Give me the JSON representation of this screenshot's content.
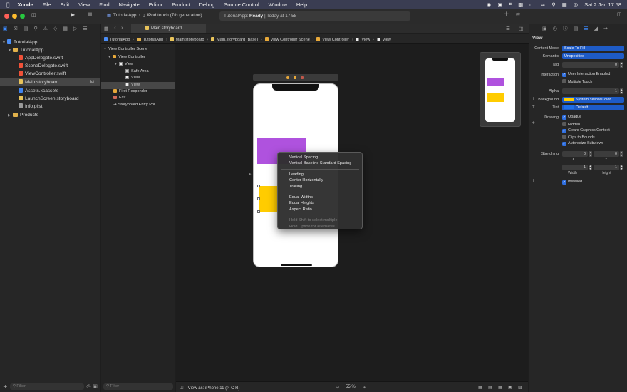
{
  "menubar": {
    "items": [
      "Xcode",
      "File",
      "Edit",
      "View",
      "Find",
      "Navigate",
      "Editor",
      "Product",
      "Debug",
      "Source Control",
      "Window",
      "Help"
    ],
    "clock": "Sat 2 Jan  17:58"
  },
  "toolbar": {
    "scheme": "TutorialApp",
    "destination": "iPod touch (7th generation)",
    "activity_app": "TutorialApp:",
    "activity_status": "Ready",
    "activity_time": "| Today at 17:58"
  },
  "editor_tab": {
    "label": "Main.storyboard"
  },
  "breadcrumbs": [
    "TutorialApp",
    "TutorialApp",
    "Main.storyboard",
    "Main.storyboard (Base)",
    "View Controller Scene",
    "View Controller",
    "View",
    "View"
  ],
  "navigator": {
    "items": [
      {
        "label": "TutorialApp",
        "kind": "project",
        "depth": 0
      },
      {
        "label": "TutorialApp",
        "kind": "folder",
        "depth": 1
      },
      {
        "label": "AppDelegate.swift",
        "kind": "swift",
        "depth": 2
      },
      {
        "label": "SceneDelegate.swift",
        "kind": "swift",
        "depth": 2
      },
      {
        "label": "ViewController.swift",
        "kind": "swift",
        "depth": 2
      },
      {
        "label": "Main.storyboard",
        "kind": "storyboard",
        "depth": 2,
        "badge": "M"
      },
      {
        "label": "Assets.xcassets",
        "kind": "assets",
        "depth": 2
      },
      {
        "label": "LaunchScreen.storyboard",
        "kind": "storyboard",
        "depth": 2
      },
      {
        "label": "Info.plist",
        "kind": "plist",
        "depth": 2
      },
      {
        "label": "Products",
        "kind": "folder",
        "depth": 1
      }
    ],
    "filter_placeholder": "Filter"
  },
  "outline": {
    "items": [
      {
        "label": "View Controller Scene",
        "depth": 0
      },
      {
        "label": "View Controller",
        "depth": 1
      },
      {
        "label": "View",
        "depth": 2
      },
      {
        "label": "Safe Area",
        "depth": 3
      },
      {
        "label": "View",
        "depth": 3
      },
      {
        "label": "View",
        "depth": 3
      },
      {
        "label": "First Responder",
        "depth": 1
      },
      {
        "label": "Exit",
        "depth": 1
      },
      {
        "label": "Storyboard Entry Poi...",
        "depth": 1
      }
    ],
    "filter_placeholder": "Filter"
  },
  "context_menu": {
    "group1": [
      "Vertical Spacing",
      "Vertical Baseline Standard Spacing"
    ],
    "group2": [
      "Leading",
      "Center Horizontally",
      "Trailing"
    ],
    "group3": [
      "Equal Widths",
      "Equal Heights",
      "Aspect Ratio"
    ],
    "hints": [
      "Hold Shift to select multiple",
      "Hold Option for alternates"
    ]
  },
  "canvas": {
    "view_as": "View as: iPhone 11 (",
    "view_as_suffix": "C  R)",
    "zoom": "55 %"
  },
  "inspector": {
    "section_view": "View",
    "content_mode_label": "Content Mode",
    "content_mode": "Scale To Fill",
    "semantic_label": "Semantic",
    "semantic": "Unspecified",
    "tag_label": "Tag",
    "tag": "0",
    "interaction_label": "Interaction",
    "user_interaction": "User Interaction Enabled",
    "multiple_touch": "Multiple Touch",
    "alpha_label": "Alpha",
    "alpha": "1",
    "background_label": "Background",
    "background": "System Yellow Color",
    "tint_label": "Tint",
    "tint": "Default",
    "drawing_label": "Drawing",
    "opaque": "Opaque",
    "hidden": "Hidden",
    "clears_graphics": "Clears Graphics Context",
    "clips_to_bounds": "Clips to Bounds",
    "autoresize": "Autoresize Subviews",
    "stretching_label": "Stretching",
    "stretch_x": "0",
    "stretch_y": "0",
    "x_label": "X",
    "y_label": "Y",
    "stretch_w": "1",
    "stretch_h": "1",
    "width_label": "Width",
    "height_label": "Height",
    "installed": "Installed"
  },
  "colors": {
    "purple_view": "#af52de",
    "yellow_view": "#ffcc00",
    "accent": "#2f6fe0"
  }
}
